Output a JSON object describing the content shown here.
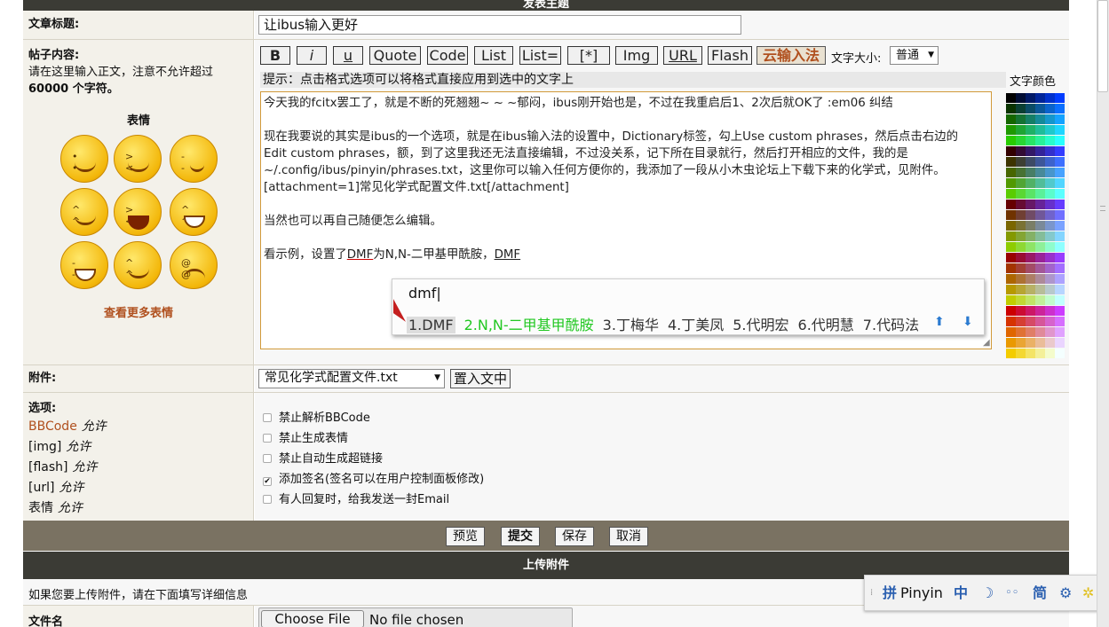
{
  "header": {
    "title": "发表主题"
  },
  "title_row": {
    "label": "文章标题:",
    "value": "让ibus输入更好"
  },
  "content_row": {
    "label": "帖子内容:",
    "note_line1": "请在这里输入正文，注意不允许超过",
    "note_line2": "60000 个字符。",
    "smilies_title": "表情",
    "more_smilies": "查看更多表情"
  },
  "toolbar": {
    "buttons": [
      "B",
      "i",
      "u",
      "Quote",
      "Code",
      "List",
      "List=",
      "[*]",
      "Img",
      "URL",
      "Flash"
    ],
    "cloud_ime": "云输入法",
    "font_size_label": "文字大小:",
    "font_size_value": "普通",
    "font_color_label": "文字颜色",
    "hint": "提示：点击格式选项可以将格式直接应用到选中的文字上"
  },
  "editor": {
    "line1": "今天我的fcitx罢工了，就是不断的死翘翘~ ~ ~郁闷，ibus刚开始也是，不过在我重启后1、2次后就OK了 :em06 纠结",
    "line2": "现在我要说的其实是ibus的一个选项，就是在ibus输入法的设置中，Dictionary标签，勾上Use custom phrases，然后点击右边的",
    "line3": "Edit custom phrases，额，到了这里我还无法直接编辑，不过没关系，记下所在目录就行，然后打开相应的文件，我的是",
    "line4": "~/.config/ibus/pinyin/phrases.txt，这里你可以输入任何方便你的，我添加了一段从小木虫论坛上下载下来的化学式，见附件。",
    "line5": "[attachment=1]常见化学式配置文件.txt[/attachment]",
    "line6": "当然也可以再自己随便怎么编辑。",
    "line7_prefix": "看示例，设置了",
    "line7_dmf": "DMF",
    "line7_mid": "为N,N-二甲基甲酰胺，",
    "line7_dmf2": "DMF"
  },
  "ime_popup": {
    "preedit": "dmf|",
    "candidates": [
      "1.DMF",
      "2.N,N-二甲基甲酰胺",
      "3.丁梅华",
      "4.丁美凤",
      "5.代明宏",
      "6.代明慧",
      "7.代码法"
    ]
  },
  "attachment_row": {
    "label": "附件:",
    "selected_file": "常见化学式配置文件.txt",
    "insert_button": "置入文中"
  },
  "options_row": {
    "label": "选项:",
    "perms": [
      {
        "name": "BBCode",
        "state": "允许"
      },
      {
        "name": "[img]",
        "state": "允许"
      },
      {
        "name": "[flash]",
        "state": "允许"
      },
      {
        "name": "[url]",
        "state": "允许"
      },
      {
        "name": "表情",
        "state": "允许"
      }
    ],
    "checkboxes": [
      {
        "label": "禁止解析BBCode",
        "checked": false
      },
      {
        "label": "禁止生成表情",
        "checked": false
      },
      {
        "label": "禁止自动生成超链接",
        "checked": false
      },
      {
        "label": "添加签名(签名可以在用户控制面板修改)",
        "checked": true
      },
      {
        "label": "有人回复时，给我发送一封Email",
        "checked": false
      }
    ]
  },
  "actions": {
    "preview": "预览",
    "submit": "提交",
    "save": "保存",
    "cancel": "取消"
  },
  "upload": {
    "header": "上传附件",
    "instruction": "如果您要上传附件，请在下面填写详细信息",
    "filename_label": "文件名",
    "choose_button": "Choose File",
    "no_file": "No file chosen"
  },
  "ime_bar": {
    "pin": "拼",
    "name": "Pinyin",
    "zh": "中",
    "jian": "简"
  },
  "colors": {
    "accent": "#b0501e",
    "header_bg": "#3b3b35",
    "label_bg": "#f3f1ea"
  }
}
